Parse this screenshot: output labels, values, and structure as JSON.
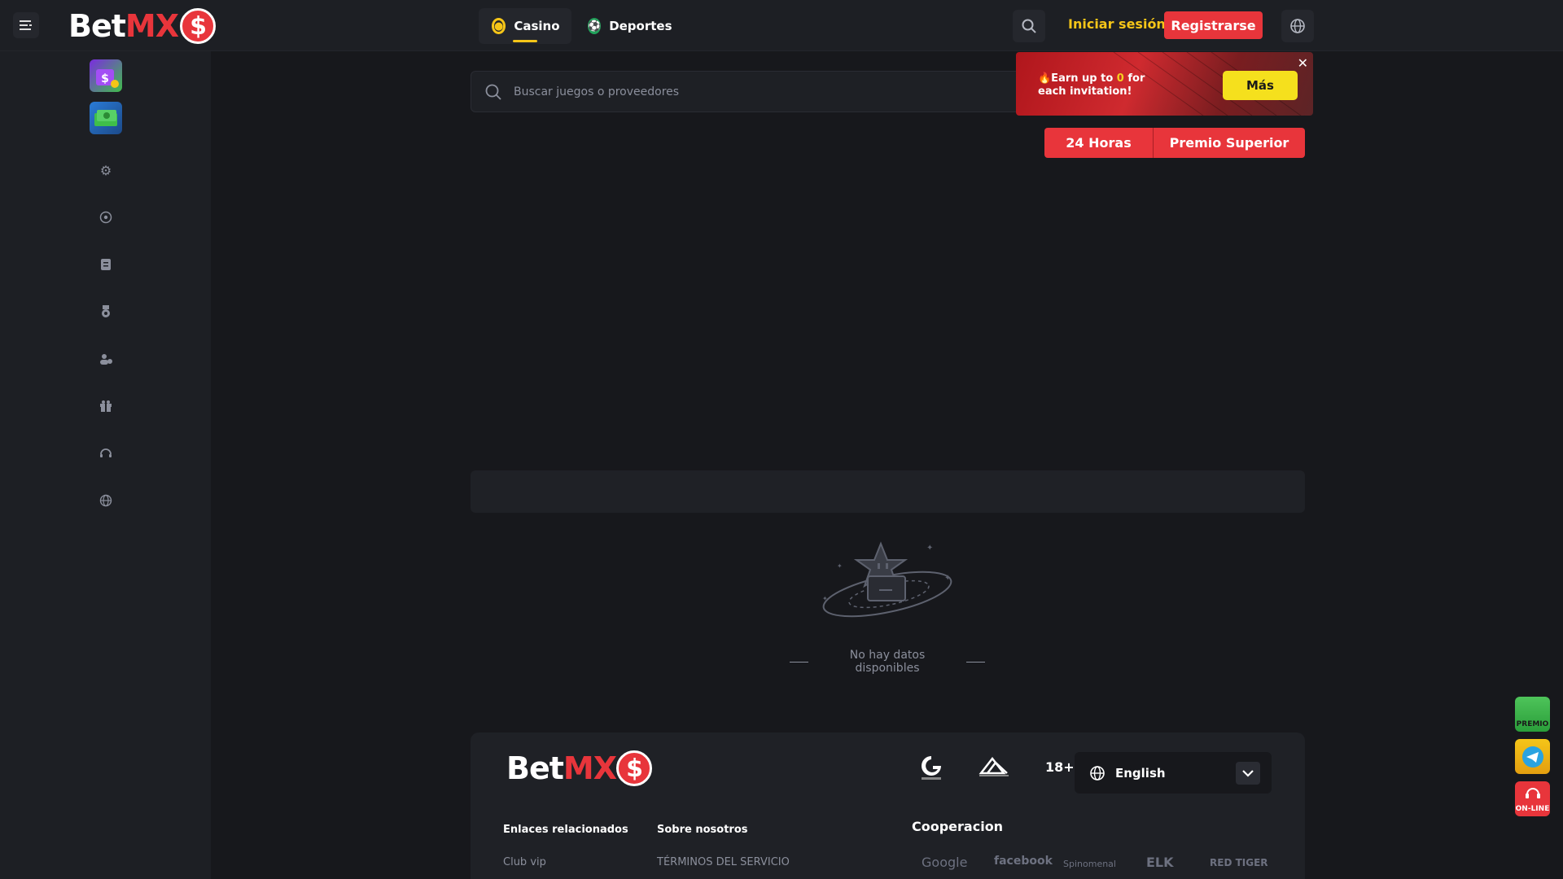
{
  "header": {
    "logo": {
      "bet": "Bet",
      "mx": "MX",
      "coin": "$"
    },
    "tabs": [
      {
        "label": "Casino",
        "active": true
      },
      {
        "label": "Deportes",
        "active": false
      }
    ],
    "login_label": "Iniciar sesión",
    "register_label": "Registrarse"
  },
  "sidebar": {
    "icons": [
      "settings-icon",
      "sports-ball-icon",
      "document-icon",
      "medal-icon",
      "community-icon",
      "gift-icon",
      "support-icon",
      "globe-icon"
    ]
  },
  "search": {
    "placeholder": "Buscar juegos o proveedores"
  },
  "invite_banner": {
    "text_before": "🔥Earn up to ",
    "amount": "0",
    "text_after": " for each invitation!",
    "button_label": "Más",
    "close": "✕"
  },
  "segment": {
    "left": "24 Horas",
    "right": "Premio Superior"
  },
  "empty_state": {
    "text": "No hay datos disponibles"
  },
  "footer": {
    "logo": {
      "bet": "Bet",
      "mx": "MX",
      "coin": "$"
    },
    "age": "18+",
    "language": "English",
    "columns": [
      {
        "heading": "Enlaces relacionados",
        "link": "Club vip"
      },
      {
        "heading": "Sobre nosotros",
        "link": "TÉRMINOS DEL SERVICIO"
      }
    ],
    "cooperation_heading": "Cooperacion",
    "partners": [
      "Google",
      "facebook",
      "Spinomenal",
      "ELK",
      "RED TIGER"
    ]
  },
  "floating": {
    "premio": "PREMIO",
    "online": "ON-LINE"
  },
  "colors": {
    "accent_red": "#e8353b",
    "accent_yellow": "#f5c518",
    "bg": "#17181c",
    "panel": "#1d1f24"
  }
}
